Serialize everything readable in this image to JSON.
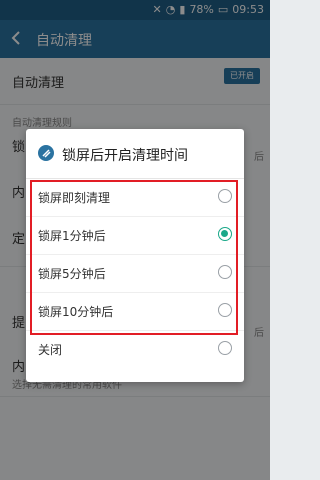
{
  "status_bar": {
    "battery": "78%",
    "time": "09:53"
  },
  "app_bar": {
    "title": "自动清理"
  },
  "settings": {
    "auto_clean_label": "自动清理",
    "auto_clean_state": "已开启",
    "section_label": "自动清理规则",
    "row_prefixes": [
      "锁",
      "内",
      "定",
      "提",
      "内"
    ],
    "row_suffix_right": "后",
    "last_row_sub": "选择无需清理的常用软件"
  },
  "dialog": {
    "title": "锁屏后开启清理时间",
    "options": [
      {
        "label": "锁屏即刻清理",
        "selected": false
      },
      {
        "label": "锁屏1分钟后",
        "selected": true
      },
      {
        "label": "锁屏5分钟后",
        "selected": false
      },
      {
        "label": "锁屏10分钟后",
        "selected": false
      },
      {
        "label": "关闭",
        "selected": false
      }
    ]
  },
  "colors": {
    "accent": "#2b73a1",
    "selected": "#1aa889",
    "highlight": "#e21d25"
  }
}
